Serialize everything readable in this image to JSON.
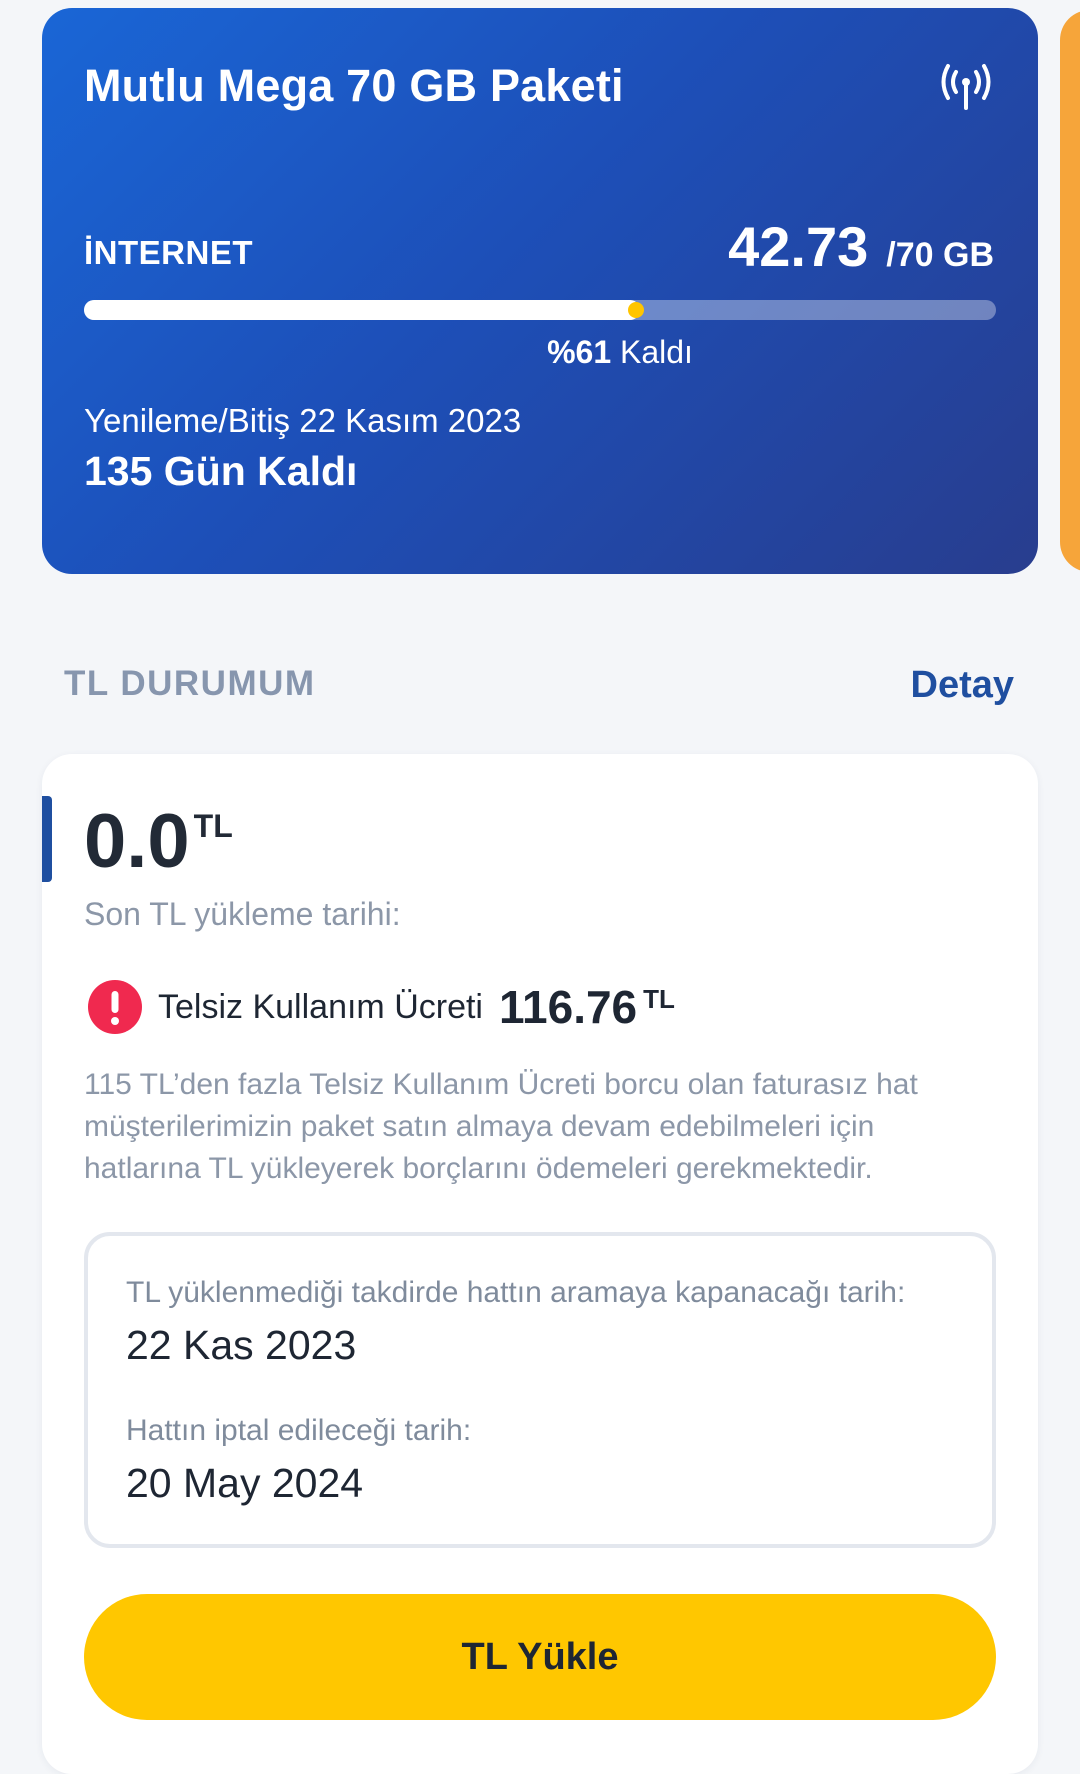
{
  "package": {
    "title": "Mutlu Mega 70 GB Paketi",
    "icon": "antenna-signal-icon",
    "internet_label": "İNTERNET",
    "used_amount": "42.73",
    "total_amount": "/70 GB",
    "remaining_fraction": 0.61,
    "remaining_pct": "%61",
    "remaining_suffix": " Kaldı",
    "renew_text": "Yenileme/Bitiş 22 Kasım 2023",
    "days_left": "135 Gün Kaldı"
  },
  "tl_status": {
    "section_title": "TL DURUMUM",
    "detail_link": "Detay",
    "balance": "0.0",
    "currency": "TL",
    "last_load_label": "Son TL yükleme tarihi:",
    "warning": {
      "icon": "exclamation-alert-icon",
      "label": "Telsiz Kullanım Ücreti",
      "amount": "116.76",
      "currency": "TL",
      "description": "115 TL’den fazla Telsiz Kullanım Ücreti borcu olan faturasız hat müşterilerimizin paket satın almaya devam edebilmeleri için hatlarına TL yükleyerek borçlarını ödemeleri gerekmektedir."
    },
    "dates": {
      "close_label": "TL yüklenmediği takdirde hattın aramaya kapanacağı tarih:",
      "close_value": "22 Kas 2023",
      "cancel_label": "Hattın iptal edileceği tarih:",
      "cancel_value": "20 May 2024"
    },
    "load_button": "TL Yükle"
  },
  "colors": {
    "card_gradient_start": "#1a66d6",
    "card_gradient_end": "#283d8e",
    "accent": "#1f4fa0",
    "button": "#ffc700",
    "alert": "#f0294f",
    "peek_card": "#f6a53a"
  }
}
